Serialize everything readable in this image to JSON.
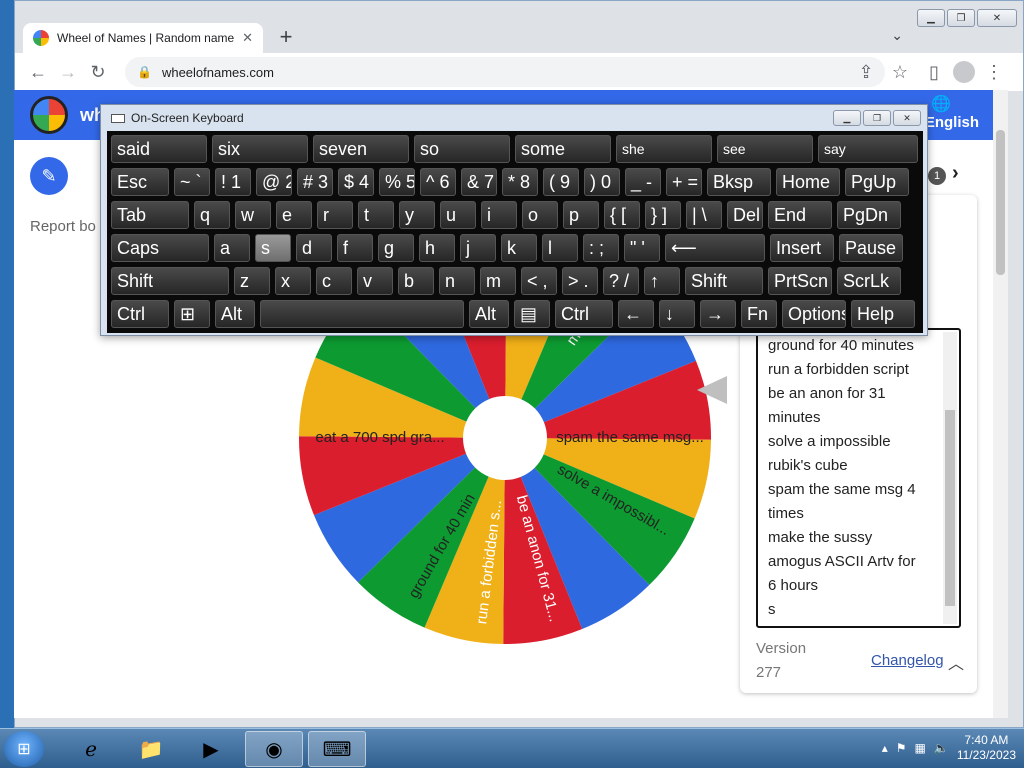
{
  "browser": {
    "tab_title": "Wheel of Names | Random name",
    "url": "wheelofnames.com"
  },
  "site": {
    "title": "wh",
    "language": "English",
    "report": "Report bo",
    "counter": "1"
  },
  "wheel": {
    "colors": [
      "#db1e2e",
      "#f0b018",
      "#0d9b31",
      "#2f69e0"
    ],
    "segments": [
      "eat a 700 spd gra...",
      "ground for 40 min",
      "run a forbidden s...",
      "be an anon for 31...",
      "solve a impossibl...",
      "spam the same msg...",
      "ma"
    ]
  },
  "entries": {
    "lines": [
      "ground for 40 minutes",
      "run a forbidden script",
      "be an anon for 31",
      "minutes",
      "solve a impossible",
      "rubik's cube",
      "spam the same msg 4",
      "times",
      "make the sussy",
      "amogus ASCII Artv for",
      "6 hours",
      "s"
    ]
  },
  "footer": {
    "version_label": "Version",
    "version_number": "277",
    "changelog": "Changelog"
  },
  "osk": {
    "title": "On-Screen Keyboard",
    "predictions": [
      "said",
      "six",
      "seven",
      "so",
      "some",
      "she",
      "see",
      "say"
    ],
    "row1": [
      "Esc",
      "~ `",
      "! 1",
      "@ 2",
      "# 3",
      "$ 4",
      "% 5",
      "^ 6",
      "& 7",
      "* 8",
      "( 9",
      ") 0",
      "_ -",
      "+ =",
      "Bksp",
      "Home",
      "PgUp"
    ],
    "row2": [
      "Tab",
      "q",
      "w",
      "e",
      "r",
      "t",
      "y",
      "u",
      "i",
      "o",
      "p",
      "{ [",
      "} ]",
      "| \\",
      "Del",
      "End",
      "PgDn"
    ],
    "row3": [
      "Caps",
      "a",
      "s",
      "d",
      "f",
      "g",
      "h",
      "j",
      "k",
      "l",
      ": ;",
      "\" '",
      "⟵",
      "Insert",
      "Pause"
    ],
    "row4": [
      "Shift",
      "z",
      "x",
      "c",
      "v",
      "b",
      "n",
      "m",
      "< ,",
      "> .",
      "? /",
      "↑",
      "Shift",
      "PrtScn",
      "ScrLk"
    ],
    "row5": [
      "Ctrl",
      "⊞",
      "Alt",
      "",
      "Alt",
      "▤",
      "Ctrl",
      "←",
      "↓",
      "→",
      "Fn",
      "Options",
      "Help"
    ]
  },
  "taskbar": {
    "time": "7:40 AM",
    "date": "11/23/2023"
  }
}
